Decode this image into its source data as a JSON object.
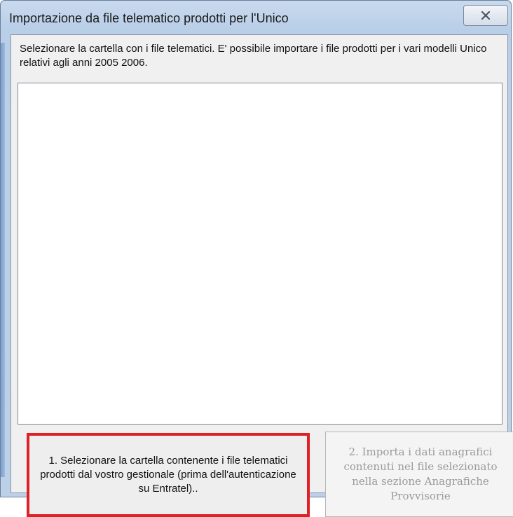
{
  "window": {
    "title": "Importazione da file telematico prodotti per l'Unico"
  },
  "content": {
    "description": "Selezionare la cartella con i file telematici. E' possibile importare i file prodotti per i vari modelli Unico relativi agli anni 2005 2006."
  },
  "buttons": {
    "select_folder_label": "1. Selezionare la cartella contenente i file telematici prodotti dal vostro gestionale (prima dell'autenticazione su Entratel)..",
    "import_label": "2. Importa i dati anagrafici contenuti nel file selezionato nella sezione Anagrafiche Provvisorie",
    "import_enabled": false
  },
  "colors": {
    "highlight_border": "#e01f26",
    "disabled_text": "#9a9a9a"
  }
}
